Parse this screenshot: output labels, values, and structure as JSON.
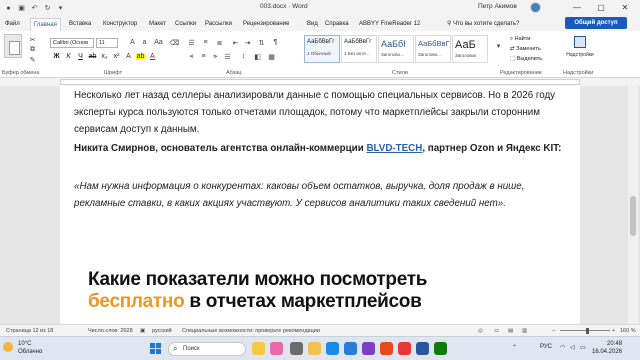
{
  "window": {
    "title": "003.docx · Word",
    "user": "Петр Акимов"
  },
  "tabs": [
    "Файл",
    "Главная",
    "Вставка",
    "Конструктор",
    "Макет",
    "Ссылки",
    "Рассылки",
    "Рецензирование",
    "Вид",
    "Справка",
    "ABBYY FineReader 12"
  ],
  "search_hint": "Что вы хотите сделать?",
  "share_label": "Общий доступ",
  "ribbon": {
    "font_name": "Calibri (Основ",
    "font_size": "11",
    "groups": {
      "clipboard": "Буфер обмена",
      "font": "Шрифт",
      "paragraph": "Абзац",
      "styles": "Стили",
      "editing": "Редактирование",
      "addins": "Надстройки"
    },
    "styles": [
      {
        "sample": "АаБбВвГг",
        "name": "1 Обычный"
      },
      {
        "sample": "АаБбВвГг",
        "name": "1 Без инте..."
      },
      {
        "sample": "АаБбI",
        "name": "Заголово..."
      },
      {
        "sample": "АаБбВвГ",
        "name": "Заголово..."
      },
      {
        "sample": "АаБ",
        "name": "Заголовок"
      }
    ],
    "edit": {
      "find": "Найти",
      "replace": "Заменить",
      "select": "Выделить"
    },
    "addins_label": "Надстройки"
  },
  "document": {
    "p1": "Несколько лет назад селлеры анализировали данные с помощью специальных сервисов. Но в 2026 году эксперты курса пользуются только отчетами площадок, потому что маркетплейсы закрыли сторонним сервисам доступ к данным.",
    "p2_before": "Никита Смирнов, основатель агентства онлайн-коммерции ",
    "p2_link": "BLVD-TECH",
    "p2_after": ", партнер Ozon и Яндекс KIT:",
    "p3": "«Нам нужна информация о конкурентах: каковы объем остатков, выручка, доля продаж в нише, рекламные ставки, в каких акциях участвуют. У сервисов аналитики таких сведений нет».",
    "banner_line1": "Какие показатели можно посмотреть",
    "banner_accent": "бесплатно",
    "banner_line2_rest": " в отчетах маркетплейсов"
  },
  "status": {
    "page": "Страница 12 из 18",
    "words": "Число слов: 2628",
    "lang": "русский",
    "accessibility": "Специальные возможности: проверьте рекомендации",
    "zoom": "160 %"
  },
  "taskbar": {
    "temp": "10°C",
    "weather": "Облачно",
    "search": "Поиск",
    "lang": "РУС",
    "time": "20:48",
    "date": "16.04.2026"
  }
}
